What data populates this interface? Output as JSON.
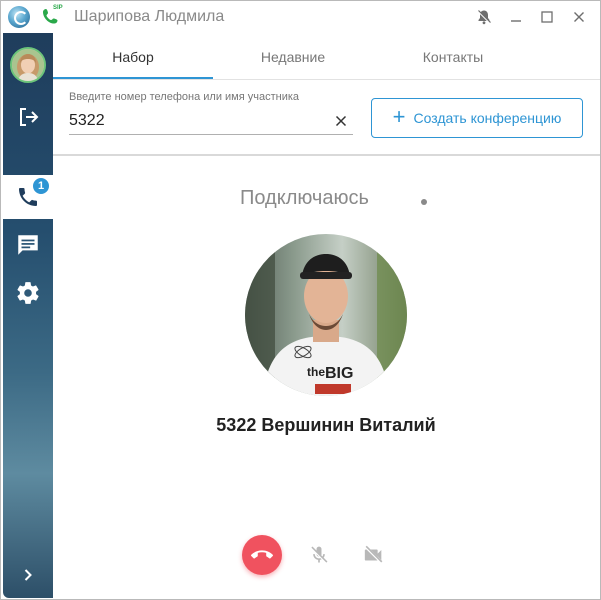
{
  "window": {
    "title": "Шарипова Людмила",
    "sip_label": "SIP"
  },
  "sidebar": {
    "call_badge_count": "1",
    "expand_icon": "chevron-right-icon"
  },
  "tabs": [
    {
      "label": "Набор",
      "active": true
    },
    {
      "label": "Недавние",
      "active": false
    },
    {
      "label": "Контакты",
      "active": false
    }
  ],
  "dial": {
    "label": "Введите номер телефона или имя участника",
    "value": "5322",
    "conference_button": "Создать конференцию"
  },
  "call": {
    "status": "Подключаюсь",
    "contact_name": "5322 Вершинин Виталий"
  },
  "colors": {
    "accent": "#2e95d4",
    "hangup": "#f0525f",
    "sidebar_top": "#1f3d5c"
  }
}
